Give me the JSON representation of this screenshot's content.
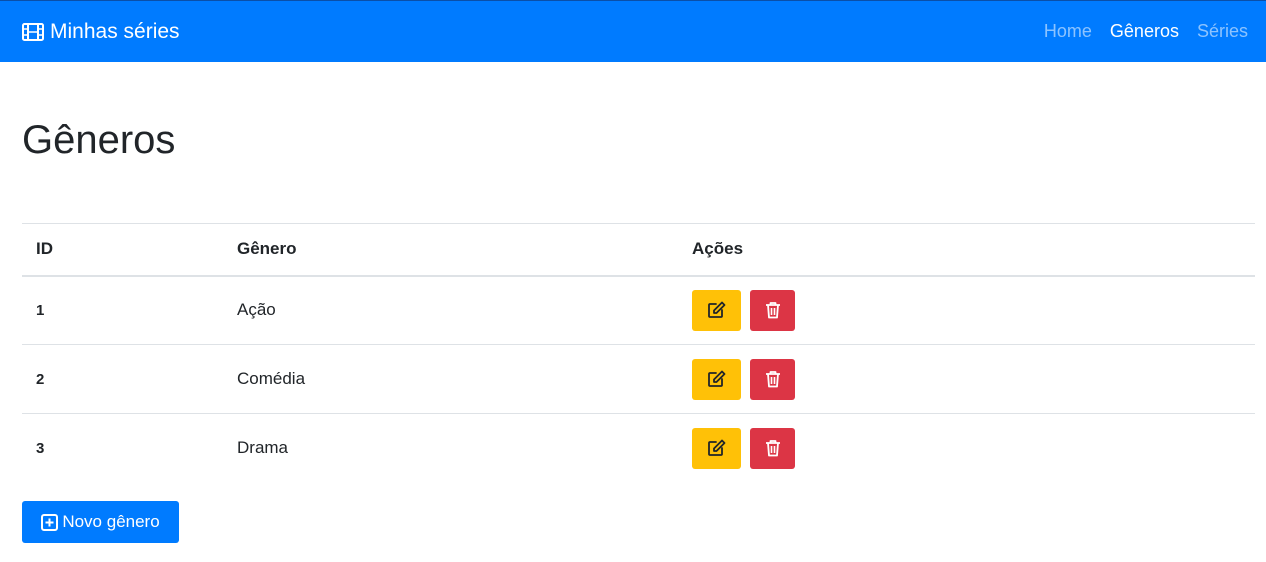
{
  "navbar": {
    "brand": "Minhas séries",
    "brand_icon": "film-icon",
    "links": [
      {
        "label": "Home",
        "active": false
      },
      {
        "label": "Gêneros",
        "active": true
      },
      {
        "label": "Séries",
        "active": false
      }
    ]
  },
  "page": {
    "title": "Gêneros"
  },
  "table": {
    "headers": {
      "id": "ID",
      "name": "Gênero",
      "actions": "Ações"
    },
    "rows": [
      {
        "id": "1",
        "name": "Ação"
      },
      {
        "id": "2",
        "name": "Comédia"
      },
      {
        "id": "3",
        "name": "Drama"
      }
    ],
    "edit_icon": "edit-icon",
    "delete_icon": "trash-icon"
  },
  "new_button": {
    "label": "Novo gênero",
    "icon": "plus-square-icon"
  },
  "colors": {
    "primary": "#007bff",
    "warning": "#ffc107",
    "danger": "#dc3545"
  }
}
